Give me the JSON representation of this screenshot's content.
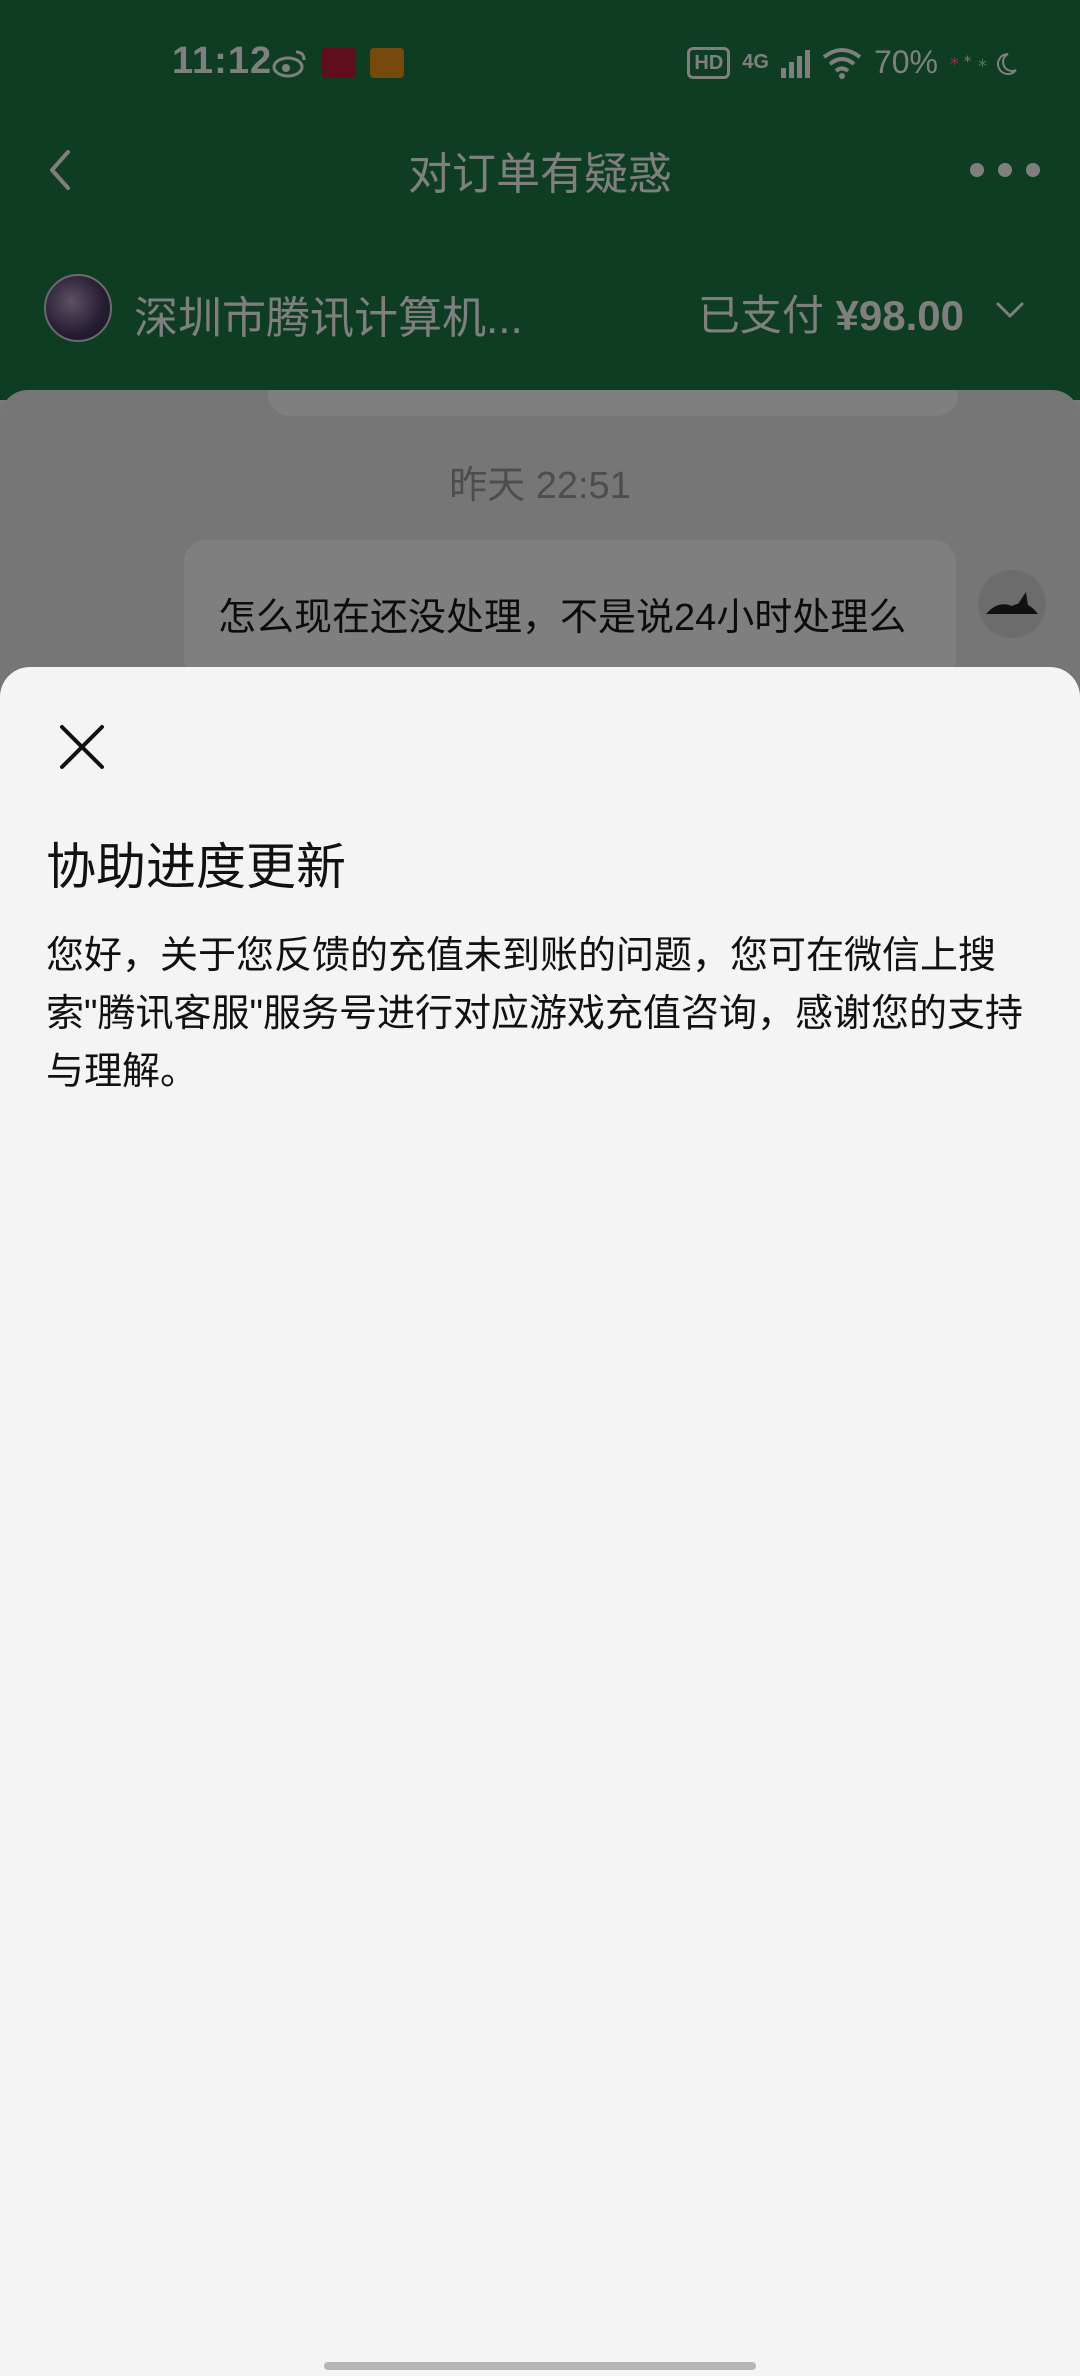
{
  "status_bar": {
    "time": "11:12",
    "hd_label": "HD",
    "network": "4G",
    "battery": "70%"
  },
  "nav": {
    "title": "对订单有疑惑"
  },
  "merchant": {
    "name": "深圳市腾讯计算机...",
    "payment_status": "已支付",
    "amount": "¥98.00"
  },
  "chat": {
    "timestamp": "昨天 22:51",
    "messages": [
      {
        "text": "怎么现在还没处理，不是说24小时处理么"
      }
    ]
  },
  "sheet": {
    "title": "协助进度更新",
    "body": "您好，关于您反馈的充值未到账的问题，您可在微信上搜索\"腾讯客服\"服务号进行对应游戏充值咨询，感谢您的支持与理解。"
  },
  "colors": {
    "header_green": "#1d7a46",
    "sheet_background": "#f4f4f4"
  }
}
